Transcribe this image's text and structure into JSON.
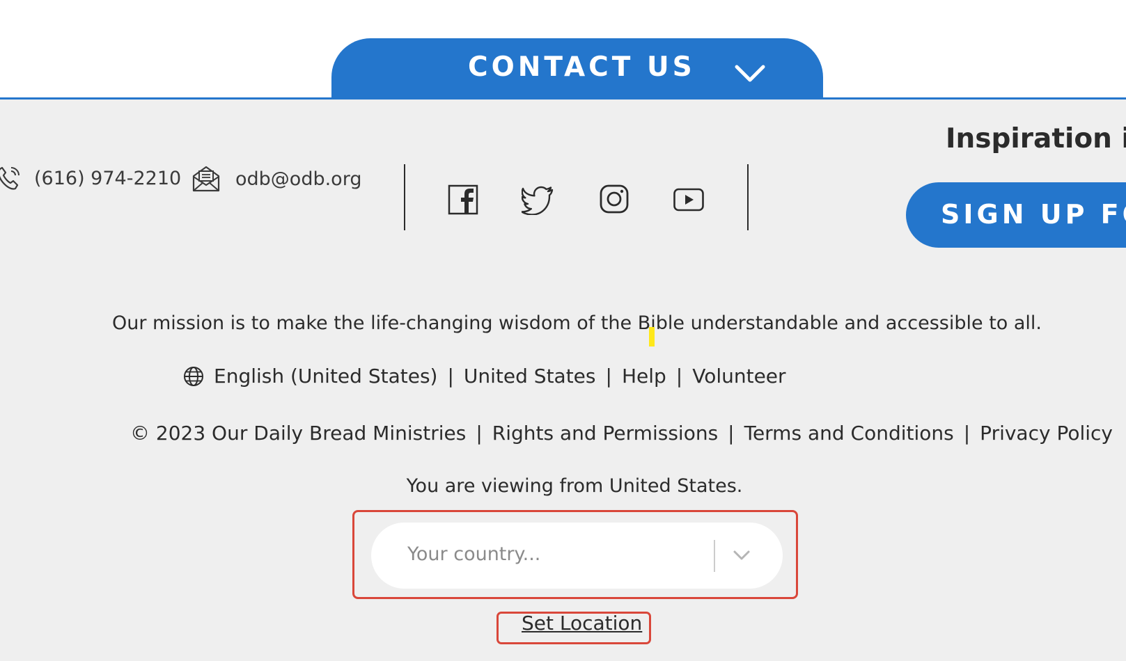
{
  "contact_tab": {
    "label": "CONTACT US",
    "icon": "chevron-down-icon"
  },
  "contact": {
    "phone": "(616) 974-2210",
    "phone_icon": "phone-icon",
    "email": "odb@odb.org",
    "email_icon": "mail-icon"
  },
  "social": [
    {
      "name": "facebook-icon"
    },
    {
      "name": "twitter-icon"
    },
    {
      "name": "instagram-icon"
    },
    {
      "name": "youtube-icon"
    }
  ],
  "newsletter": {
    "heading": "Inspiration in Y",
    "button_label": "SIGN UP FOR"
  },
  "mission": "Our mission is to make the life-changing wisdom of the Bible understandable and accessible to all.",
  "links_row": {
    "globe_icon": "globe-icon",
    "language": "English (United States)",
    "country": "United States",
    "help": "Help",
    "volunteer": "Volunteer",
    "separator": "|"
  },
  "legal_row": {
    "copyright": "© 2023 Our Daily Bread Ministries",
    "rights": "Rights and Permissions",
    "terms": "Terms and Conditions",
    "privacy": "Privacy Policy",
    "separator": "|"
  },
  "location": {
    "viewing_text": "You are viewing from United States.",
    "country_placeholder": "Your country...",
    "set_location_label": "Set Location"
  },
  "colors": {
    "brand_blue": "#2476cc",
    "footer_bg": "#efefef",
    "highlight_red": "#d9473a"
  }
}
